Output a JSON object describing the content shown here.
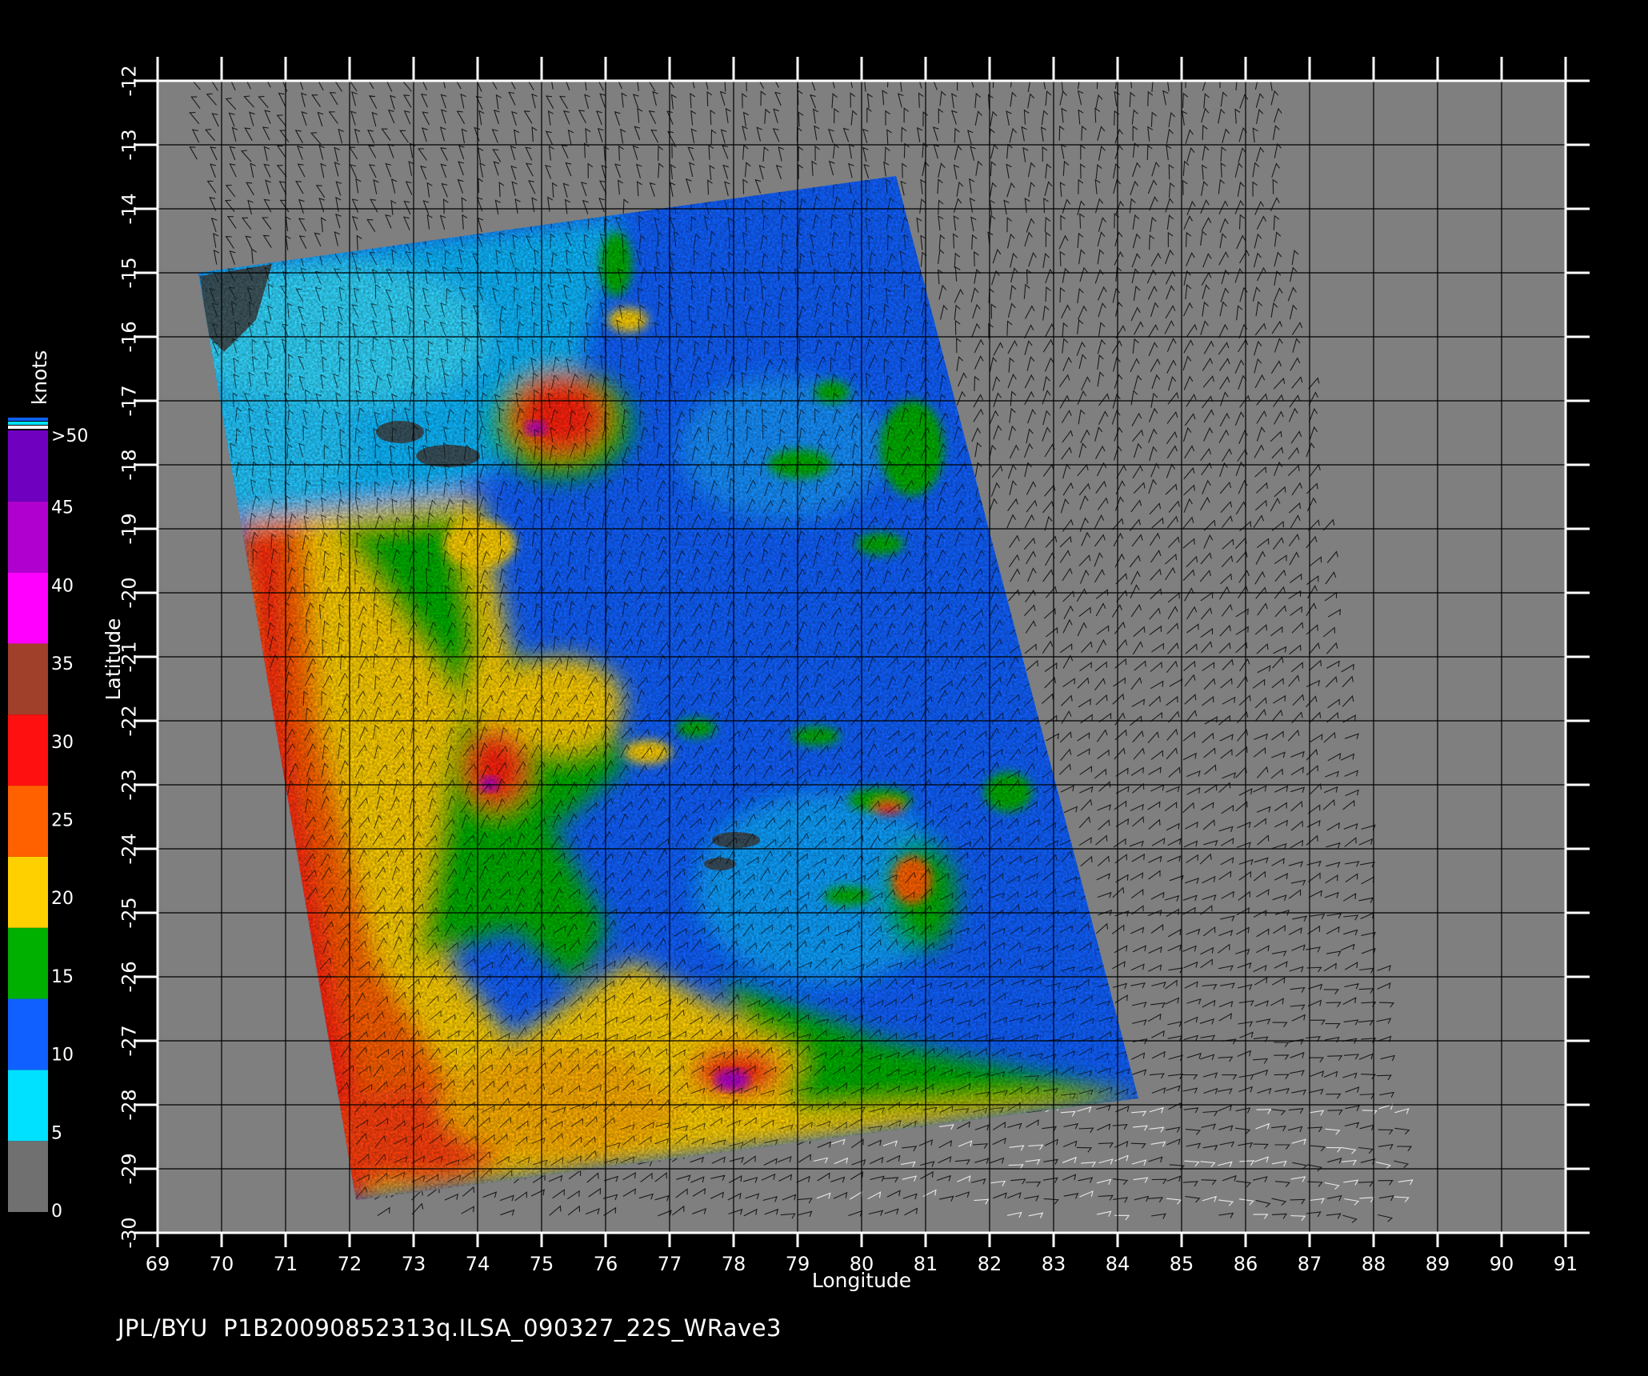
{
  "map": {
    "lon_ticks": [
      "69",
      "70",
      "71",
      "72",
      "73",
      "74",
      "75",
      "76",
      "77",
      "78",
      "79",
      "80",
      "81",
      "82",
      "83",
      "84",
      "85",
      "86",
      "87",
      "88",
      "89",
      "90",
      "91"
    ],
    "lat_ticks": [
      "-12",
      "-13",
      "-14",
      "-15",
      "-16",
      "-17",
      "-18",
      "-19",
      "-20",
      "-21",
      "-22",
      "-23",
      "-24",
      "-25",
      "-26",
      "-27",
      "-28",
      "-29",
      "-30"
    ],
    "lon_range": [
      69,
      91
    ],
    "lat_range": [
      -12,
      -30
    ],
    "xlabel": "Longitude",
    "ylabel": "Latitude",
    "background_color": "#7f7f7f",
    "grid_color": "#000000"
  },
  "colorbar": {
    "title": "knots",
    "labels": [
      ">50",
      "45",
      "40",
      "35",
      "30",
      "25",
      "20",
      "15",
      "10",
      "5",
      "0"
    ],
    "segments": [
      {
        "range": "0-5",
        "color": "#707070"
      },
      {
        "range": "5-10",
        "color": "#00e0ff"
      },
      {
        "range": "10-15",
        "color": "#1060ff"
      },
      {
        "range": "15-20",
        "color": "#00b000"
      },
      {
        "range": "20-25",
        "color": "#ffd000"
      },
      {
        "range": "25-30",
        "color": "#ff6000"
      },
      {
        "range": "30-35",
        "color": "#ff1010"
      },
      {
        "range": "35-40",
        "color": "#a0402a"
      },
      {
        "range": "40-45",
        "color": "#ff00ff"
      },
      {
        "range": "45-50",
        "color": "#b000d0"
      },
      {
        "range": ">50",
        "color": "#7000c0"
      }
    ]
  },
  "footer": "JPL/BYU  P1B20090852313q.ILSA_090327_22S_WRave3"
}
